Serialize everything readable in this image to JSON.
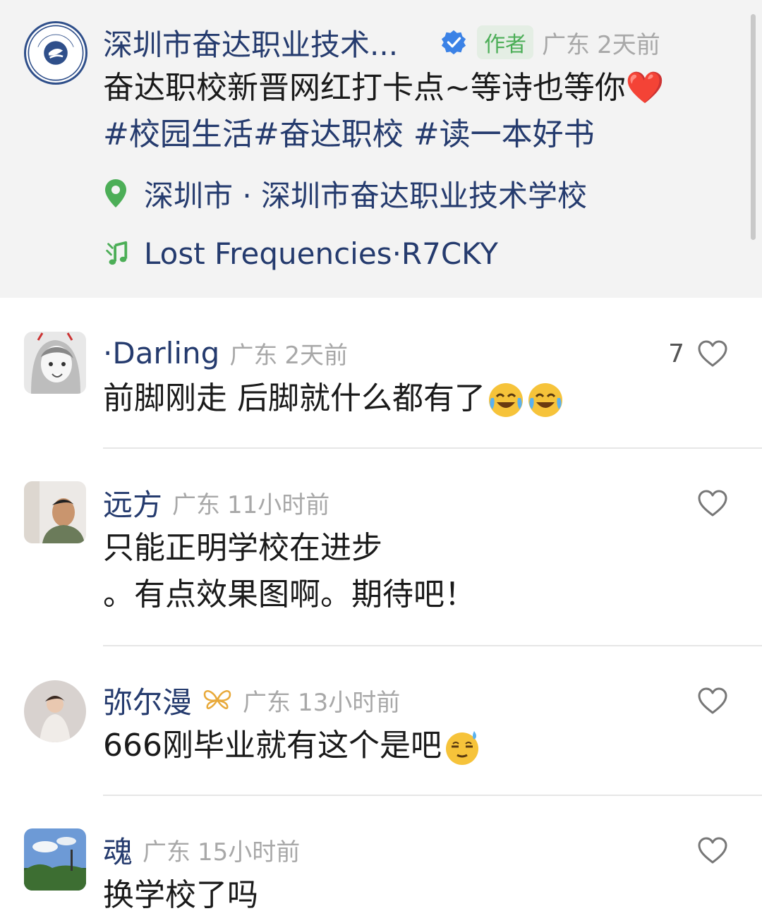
{
  "post": {
    "author_name": "深圳市奋达职业技术...",
    "author_tag": "作者",
    "region": "广东",
    "time": "2天前",
    "text": "奋达职校新晋网红打卡点~等诗也等你",
    "heart": "❤️",
    "hashtags": "#校园生活#奋达职校 #读一本好书",
    "location": "深圳市 · 深圳市奋达职业技术学校",
    "music": "Lost Frequencies·R7CKY",
    "avatar_text": "FENDA EDUCATION"
  },
  "comments": [
    {
      "name": "·Darling",
      "region": "广东",
      "time": "2天前",
      "text": "前脚刚走 后脚就什么都有了",
      "likes": "7"
    },
    {
      "name": "远方",
      "region": "广东",
      "time": "11小时前",
      "text_line1": "只能正明学校在进步",
      "text_line2": "。有点效果图啊。期待吧！",
      "likes": ""
    },
    {
      "name": "弥尔漫",
      "region": "广东",
      "time": "13小时前",
      "text": "666刚毕业就有这个是吧",
      "likes": ""
    },
    {
      "name": "魂",
      "region": "广东",
      "time": "15小时前",
      "text": "换学校了吗",
      "likes": ""
    }
  ],
  "colors": {
    "name_blue": "#253b6e",
    "meta_gray": "#a8a8a8",
    "location_green": "#4cae57",
    "heart_red": "#e02a2a",
    "header_bg": "#f3f3f3"
  }
}
